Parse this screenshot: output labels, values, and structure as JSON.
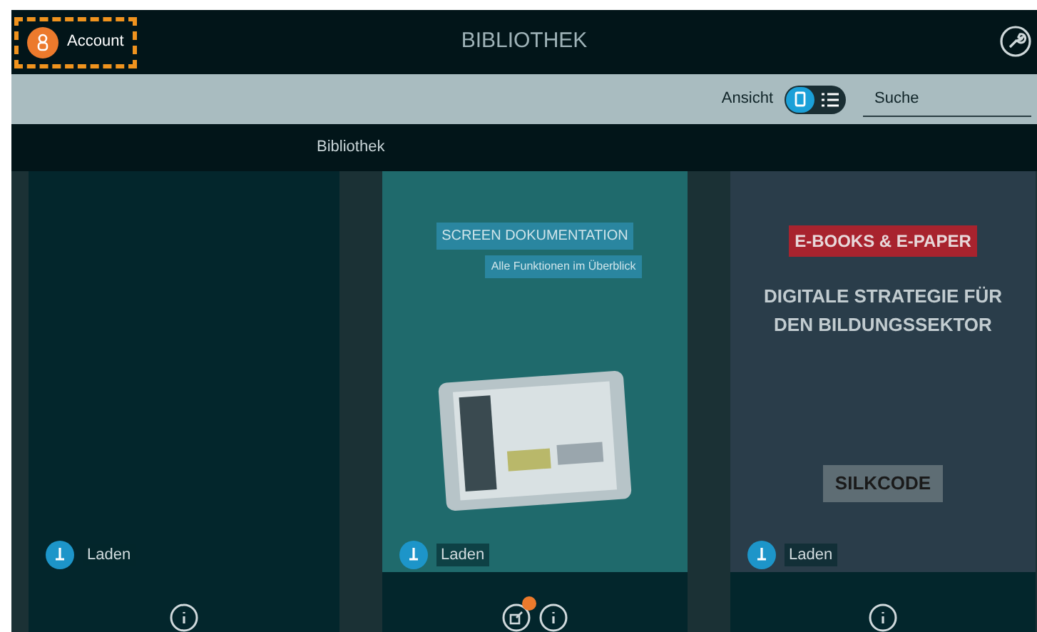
{
  "header": {
    "account": {
      "label": "Account",
      "highlighted": true
    },
    "title": "BIBLIOTHEK"
  },
  "toolbar": {
    "view_label": "Ansicht",
    "views": [
      {
        "kind": "grid",
        "selected": true
      },
      {
        "kind": "list",
        "selected": false
      }
    ],
    "search": {
      "placeholder": "Suche"
    }
  },
  "section_title": "Bibliothek",
  "books": [
    {
      "cover": {
        "kind": "blank"
      },
      "download_label": "Laden",
      "actions": [
        {
          "kind": "info",
          "badge": false
        }
      ]
    },
    {
      "cover": {
        "kind": "tablet",
        "title": "SCREEN DOKUMENTATION",
        "subtitle": "Alle Funktionen im Überblick"
      },
      "download_label": "Laden",
      "actions": [
        {
          "kind": "share",
          "badge": true
        },
        {
          "kind": "info",
          "badge": false
        }
      ]
    },
    {
      "cover": {
        "kind": "city",
        "tag": "E-BOOKS & E-PAPER",
        "title": "DIGITALE STRATEGIE FÜR DEN BILDUNGSSEKTOR",
        "brand": "SILKCODE"
      },
      "download_label": "Laden",
      "actions": [
        {
          "kind": "info",
          "badge": false
        }
      ]
    }
  ]
}
